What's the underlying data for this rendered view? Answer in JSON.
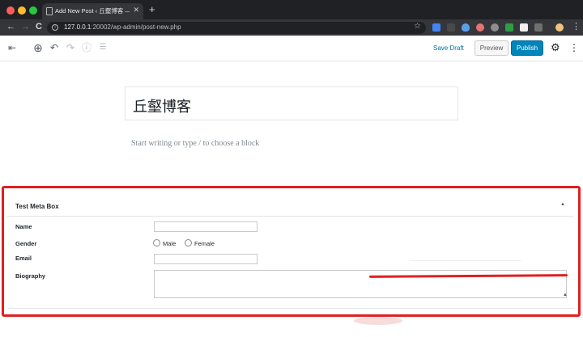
{
  "browser": {
    "tab_title": "Add New Post ‹ 丘壑博客 — Wo",
    "tab_close": "✕",
    "new_tab": "+",
    "nav_back": "←",
    "nav_forward": "→",
    "nav_reload": "C",
    "url_host": "127.0.0.1",
    "url_path": ":20002/wp-admin/post-new.php",
    "star": "☆",
    "menu": "⋮"
  },
  "toolbar": {
    "inserter": "⊕",
    "undo": "↶",
    "redo": "↷",
    "info": "ⓘ",
    "outline": "☰",
    "save_draft": "Save Draft",
    "preview": "Preview",
    "publish": "Publish",
    "settings": "⚙",
    "more": "⋮",
    "sidebar_toggle": "⇤"
  },
  "editor": {
    "post_title": "丘壑博客",
    "block_placeholder": "Start writing or type / to choose a block"
  },
  "meta_box": {
    "title": "Test Meta Box",
    "toggle": "▲",
    "name_label": "Name",
    "gender_label": "Gender",
    "gender_options": [
      "Male",
      "Female"
    ],
    "email_label": "Email",
    "biography_label": "Biography",
    "resize": "▲"
  },
  "colors": {
    "highlight": "#e0201f",
    "publish": "#0085ba",
    "link": "#0073aa"
  }
}
